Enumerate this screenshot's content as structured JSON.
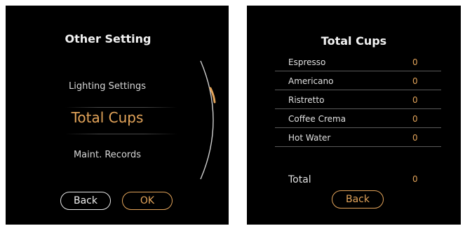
{
  "left_screen": {
    "title": "Other Setting",
    "menu_items": [
      {
        "label": "Lighting Settings"
      },
      {
        "label": "Total Cups"
      },
      {
        "label": "Maint. Records"
      }
    ],
    "back_label": "Back",
    "ok_label": "OK"
  },
  "right_screen": {
    "title": "Total Cups",
    "rows": [
      {
        "label": "Espresso",
        "value": "0"
      },
      {
        "label": "Americano",
        "value": "0"
      },
      {
        "label": "Ristretto",
        "value": "0"
      },
      {
        "label": "Coffee Crema",
        "value": "0"
      },
      {
        "label": "Hot Water",
        "value": "0"
      }
    ],
    "total_label": "Total",
    "total_value": "0",
    "back_label": "Back"
  },
  "colors": {
    "background": "#000000",
    "accent": "#e3a45a",
    "text": "#e0e0e0",
    "divider": "#5a5a5a"
  }
}
